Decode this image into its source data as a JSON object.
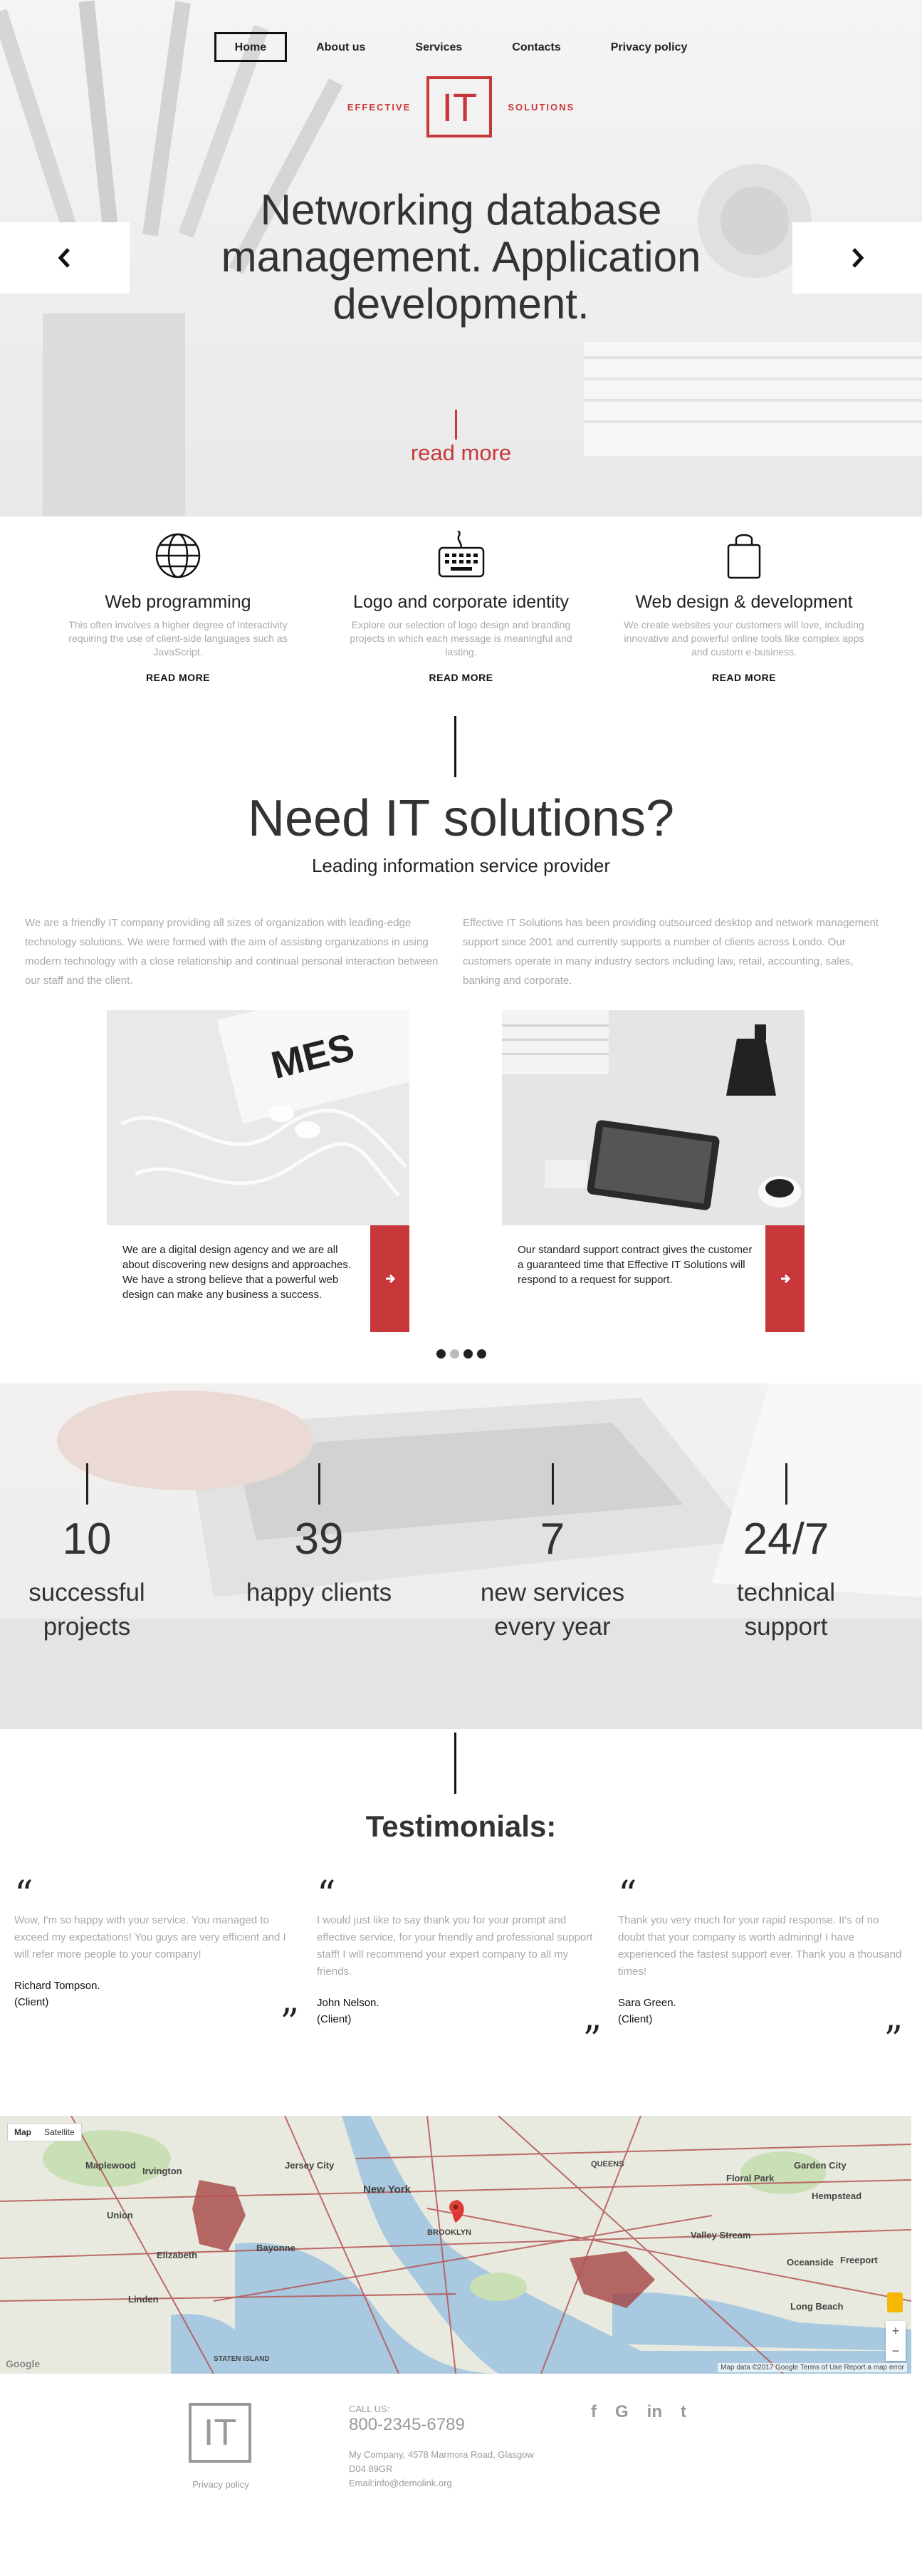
{
  "nav": {
    "items": [
      {
        "label": "Home"
      },
      {
        "label": "About us"
      },
      {
        "label": "Services"
      },
      {
        "label": "Contacts"
      },
      {
        "label": "Privacy policy"
      }
    ]
  },
  "logo": {
    "left": "EFFECTIVE",
    "mark": "IT",
    "right": "SOLUTIONS"
  },
  "hero": {
    "title": "Networking database management. Application development.",
    "read_more": "read more",
    "prev_icon": "chevron-left-icon",
    "next_icon": "chevron-right-icon"
  },
  "features": [
    {
      "icon": "globe-icon",
      "title": "Web programming",
      "text": "This often involves a higher degree of interactivity requiring the use of client-side languages such as JavaScript.",
      "link": "READ MORE"
    },
    {
      "icon": "keyboard-icon",
      "title": "Logo and corporate identity",
      "text": "Explore our selection of logo design and branding projects in which each message is meaningful and lasting.",
      "link": "READ MORE"
    },
    {
      "icon": "shopping-bag-icon",
      "title": "Web design & development",
      "text": "We create websites your customers will love, including innovative and powerful online tools like complex apps and custom e-business.",
      "link": "READ MORE"
    }
  ],
  "need": {
    "title": "Need IT solutions?",
    "subtitle": "Leading information service provider",
    "col_left": "We are a friendly IT company providing all sizes of organization with leading-edge technology solutions. We were formed with the aim of assisting organizations in using modern technology with a close relationship and continual personal interaction between our staff and the client.",
    "col_right": "Effective IT Solutions has been providing outsourced desktop and network management support since 2001 and currently supports a number of clients across Londo. Our customers operate in many industry sectors including law, retail, accounting, sales, banking and corporate."
  },
  "cards": [
    {
      "text": "We are a digital design agency and we are all about discovering new designs and approaches. We have a strong believe that a powerful web design can make any business a success.",
      "button_icon": "arrow-right-icon",
      "image": "headphones-photo"
    },
    {
      "text": "Our standard support contract gives the customer a guaranteed time that Effective IT Solutions will respond to a request for support.",
      "button_icon": "arrow-right-icon",
      "image": "coffee-tablet-photo"
    }
  ],
  "slider_dots": 4,
  "stats": [
    {
      "number": "10",
      "label_1": "successful",
      "label_2": "projects"
    },
    {
      "number": "39",
      "label_1": "happy clients",
      "label_2": ""
    },
    {
      "number": "7",
      "label_1": "new services",
      "label_2": "every year"
    },
    {
      "number": "24/7",
      "label_1": "technical",
      "label_2": "support"
    }
  ],
  "testimonials": {
    "title": "Testimonials:",
    "open_quote": "“",
    "close_quote": "”",
    "items": [
      {
        "text": "Wow, I'm so happy with your service. You managed to exceed my expectations! You guys are very efficient and I will refer more people to your company!",
        "name": "Richard Tompson.",
        "role": "(Client)"
      },
      {
        "text": "I would just like to say thank you for your prompt and effective service, for your friendly and professional support staff! I will recommend your expert company to all my friends.",
        "name": "John Nelson.",
        "role": "(Client)"
      },
      {
        "text": "Thank you very much for your rapid response. It's of no doubt that your company is worth admiring! I have experienced the fastest support ever. Thank you a thousand times!",
        "name": "Sara Green.",
        "role": "(Client)"
      }
    ]
  },
  "map": {
    "tab_map": "Map",
    "tab_satellite": "Satellite",
    "labels": [
      "Jersey City",
      "New York",
      "QUEENS",
      "BROOKLYN",
      "Elizabeth",
      "Bayonne",
      "Garden City",
      "Hempstead",
      "Long Beach",
      "Oceanside",
      "Union",
      "Linden",
      "STATEN ISLAND",
      "Maplewood",
      "Irvington",
      "Floral Park",
      "Valley Stream",
      "Freeport"
    ],
    "footer": "Map data ©2017 Google   Terms of Use   Report a map error",
    "google": "Google",
    "zoom_in": "+",
    "zoom_out": "−",
    "colors": {
      "water": "#a9c9e0",
      "land": "#e8eadf",
      "park": "#c9dfb5",
      "road": "#b55454",
      "area": "#a33a3a"
    }
  },
  "footer": {
    "logo": "IT",
    "policy": "Privacy policy",
    "call_label": "CALL US:",
    "phone": "800-2345-6789",
    "address_1": "My Company, 4578 Marmora Road, Glasgow",
    "address_2": "D04 89GR",
    "email": "Email:info@demolink.org",
    "social": [
      {
        "icon": "facebook-icon",
        "glyph": "f"
      },
      {
        "icon": "google-plus-icon",
        "glyph": "G"
      },
      {
        "icon": "linkedin-icon",
        "glyph": "in"
      },
      {
        "icon": "twitter-icon",
        "glyph": "t"
      }
    ]
  },
  "colors": {
    "accent": "#c8383a",
    "text": "#333333",
    "muted": "#a8a8a8"
  }
}
